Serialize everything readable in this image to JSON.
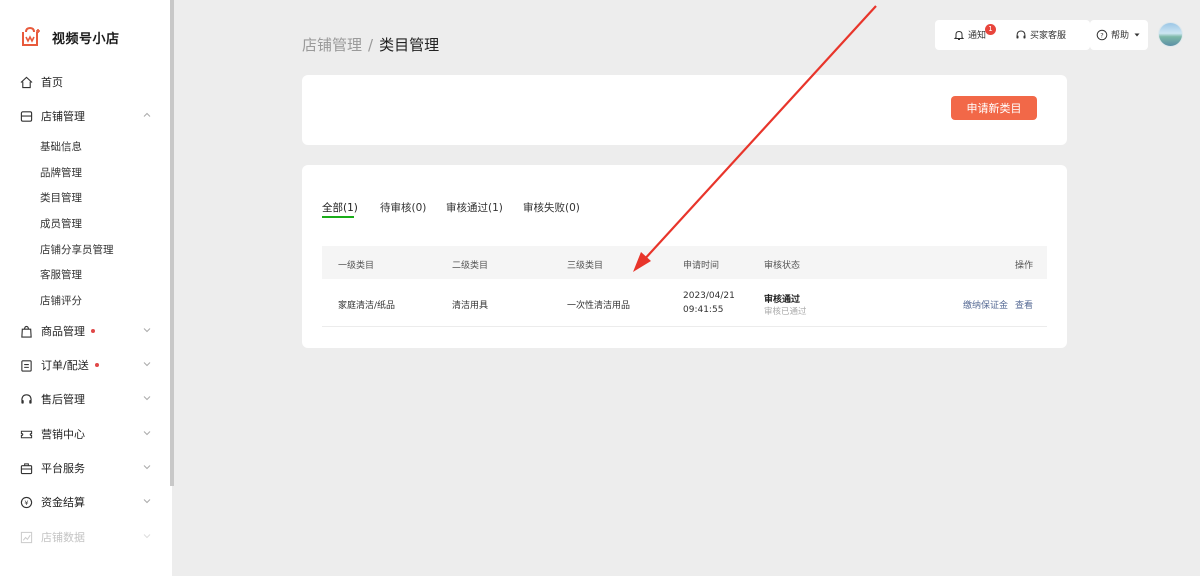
{
  "brand": {
    "name": "视频号小店"
  },
  "nav": {
    "home": "首页",
    "store": {
      "label": "店铺管理",
      "sub": [
        "基础信息",
        "品牌管理",
        "类目管理",
        "成员管理",
        "店铺分享员管理",
        "客服管理",
        "店铺评分"
      ]
    },
    "goods": "商品管理",
    "orders": "订单/配送",
    "aftersale": "售后管理",
    "marketing": "营销中心",
    "platform": "平台服务",
    "finance": "资金结算",
    "data": "店铺数据"
  },
  "breadcrumb": {
    "parent": "店铺管理",
    "separator": "/",
    "current": "类目管理"
  },
  "topbar": {
    "notify": "通知",
    "notify_count": "1",
    "service": "买家客服",
    "help": "帮助"
  },
  "actions": {
    "apply": "申请新类目"
  },
  "tabs": [
    "全部(1)",
    "待审核(0)",
    "审核通过(1)",
    "审核失败(0)"
  ],
  "table": {
    "headers": [
      "一级类目",
      "二级类目",
      "三级类目",
      "申请时间",
      "审核状态",
      "操作"
    ],
    "rows": [
      {
        "level1": "家庭清洁/纸品",
        "level2": "清洁用具",
        "level3": "一次性清洁用品",
        "date": "2023/04/21",
        "time": "09:41:55",
        "status": "审核通过",
        "status_sub": "审核已通过",
        "op_deposit": "缴纳保证金",
        "op_view": "查看"
      }
    ]
  },
  "colors": {
    "accent": "#f26848",
    "link": "#576b95",
    "active_tab": "#1aad19",
    "arrow": "#e8352b"
  }
}
